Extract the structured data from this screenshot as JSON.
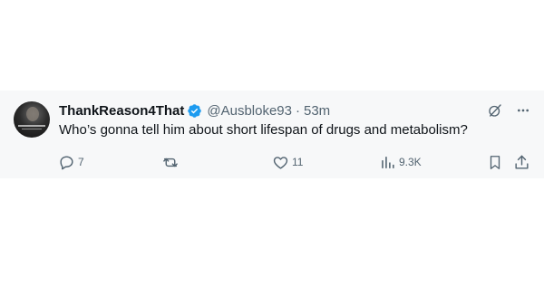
{
  "tweet": {
    "author_name": "ThankReason4That",
    "handle": "@Ausbloke93",
    "separator": "·",
    "time": "53m",
    "verified": true,
    "text": "Who’s gonna tell him about short lifespan of drugs and metabolism?",
    "stats": {
      "replies": "7",
      "reposts": "",
      "likes": "11",
      "views": "9.3K"
    }
  },
  "icons": {
    "avatar": "profile-avatar",
    "verified": "verified-badge-icon",
    "grok": "grok-icon",
    "more": "more-icon",
    "reply": "reply-icon",
    "repost": "repost-icon",
    "like": "like-icon",
    "views": "views-icon",
    "bookmark": "bookmark-icon",
    "share": "share-icon"
  },
  "colors": {
    "text_primary": "#0f1419",
    "text_secondary": "#536471",
    "verified_blue": "#1d9bf0",
    "tweet_background": "#f7f8f9"
  }
}
